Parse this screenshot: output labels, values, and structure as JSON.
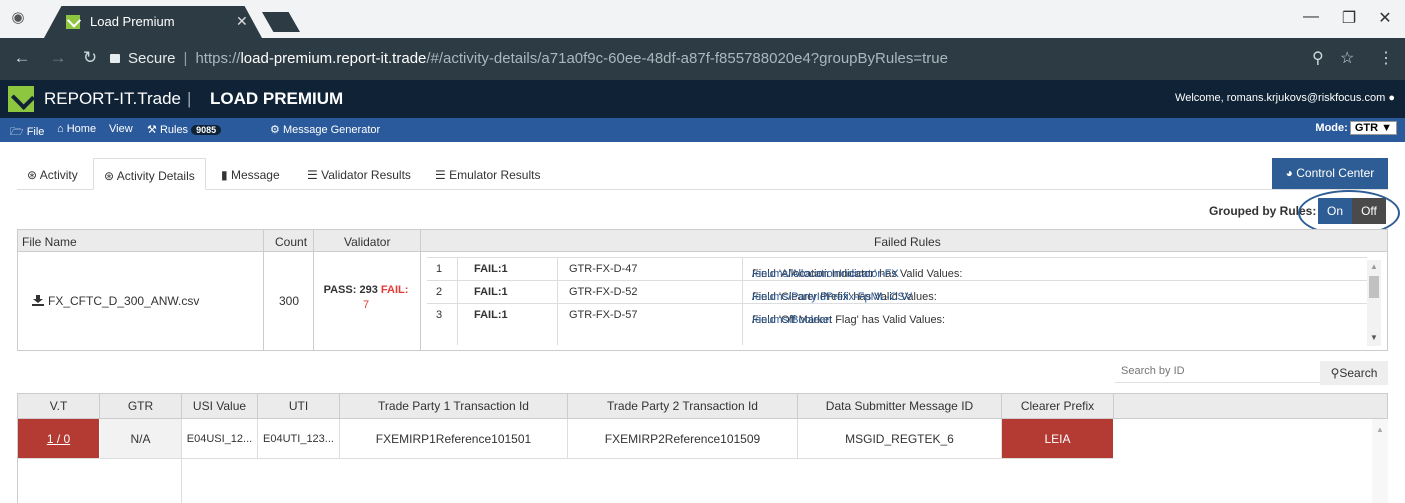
{
  "browser": {
    "tab_title": "Load Premium",
    "url_secure_label": "Secure",
    "url_scheme": "https://",
    "url_host": "load-premium.report-it.trade",
    "url_path": "/#/activity-details/a71a0f9c-60ee-48df-a87f-f855788020e4?groupByRules=true"
  },
  "app": {
    "brand": "REPORT-IT.Trade",
    "divider": "|",
    "product": "LOAD PREMIUM",
    "welcome": "Welcome, romans.krjukovs@riskfocus.com"
  },
  "menu": {
    "file": "File",
    "home": "Home",
    "view": "View",
    "rules": "Rules",
    "rules_count": "9085",
    "message_generator": "Message Generator",
    "mode_label": "Mode:",
    "mode_value": "GTR"
  },
  "tabs": [
    "Activity",
    "Activity Details",
    "Message",
    "Validator Results",
    "Emulator Results"
  ],
  "control_center": "Control Center",
  "grouped": {
    "label": "Grouped by Rules:",
    "on": "On",
    "off": "Off"
  },
  "summary": {
    "headers": [
      "File Name",
      "Count",
      "Validator",
      "Failed Rules"
    ],
    "file_name": "FX_CFTC_D_300_ANW.csv",
    "count": "300",
    "pass_label": "PASS:",
    "pass_value": "293",
    "fail_label": "FAIL:",
    "fail_value": "7",
    "failed_rules": [
      {
        "num": "1",
        "fail": "FAIL:1",
        "rule": "GTR-FX-D-47",
        "desc": "Field 'Allocation Indicator' has Valid Values:",
        "link": "/enums/AllocationIndicator-FX"
      },
      {
        "num": "2",
        "fail": "FAIL:1",
        "rule": "GTR-FX-D-52",
        "desc": "Field 'Clearer Prefix' has Valid Values:",
        "link": "/enums/PartyIdPrefix-FpML-CSV"
      },
      {
        "num": "3",
        "fail": "FAIL:1",
        "rule": "GTR-FX-D-57",
        "desc": "Field 'Off Market Flag' has Valid Values:",
        "link": "/enums/Boolean"
      }
    ]
  },
  "search": {
    "placeholder": "Search by ID",
    "button": "Search"
  },
  "grid": {
    "headers": [
      "V.T",
      "GTR",
      "USI Value",
      "UTI",
      "Trade Party 1 Transaction Id",
      "Trade Party 2 Transaction Id",
      "Data Submitter Message ID",
      "Clearer Prefix"
    ],
    "row": {
      "vt": "1 / 0",
      "gtr": "N/A",
      "usi": "E04USI_12...",
      "uti": "E04UTI_123...",
      "tp1": "FXEMIRP1Reference101501",
      "tp2": "FXEMIRP2Reference101509",
      "msgid": "MSGID_REGTEK_6",
      "clearer": "LEIA"
    }
  },
  "colors": {
    "app_header": "#0f2236",
    "menubar": "#2a5a9b",
    "accent": "#2e5d95",
    "fail_red": "#e53935",
    "error_cell": "#b33b34",
    "logo_green": "#8dc63f"
  }
}
